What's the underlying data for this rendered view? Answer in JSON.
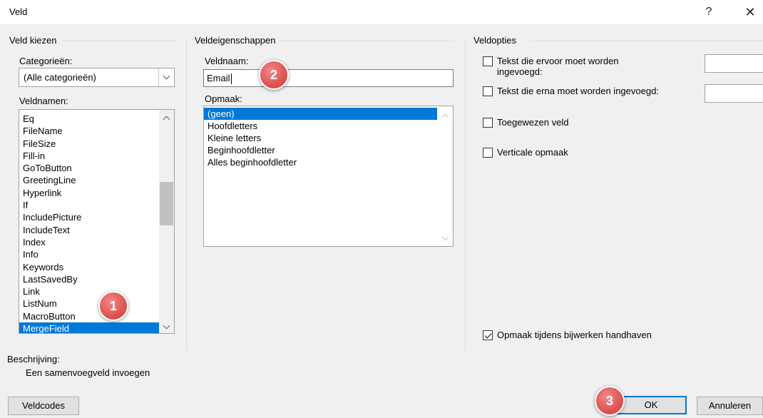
{
  "dialog": {
    "title": "Veld",
    "help": "?",
    "close": "✕"
  },
  "field_choose": {
    "legend": "Veld kiezen",
    "categories_label": "Categorieën:",
    "category_value": "(Alle categorieën)",
    "fieldnames_label": "Veldnamen:",
    "fieldnames": [
      "Eq",
      "FileName",
      "FileSize",
      "Fill-in",
      "GoToButton",
      "GreetingLine",
      "Hyperlink",
      "If",
      "IncludePicture",
      "IncludeText",
      "Index",
      "Info",
      "Keywords",
      "LastSavedBy",
      "Link",
      "ListNum",
      "MacroButton",
      "MergeField"
    ],
    "selected": "MergeField"
  },
  "field_props": {
    "legend": "Veldeigenschappen",
    "fieldname_label": "Veldnaam:",
    "fieldname_value": "Email",
    "format_label": "Opmaak:",
    "formats": [
      "(geen)",
      "Hoofdletters",
      "Kleine letters",
      "Beginhoofdletter",
      "Alles beginhoofdletter"
    ],
    "selected_format": "(geen)"
  },
  "field_options": {
    "legend": "Veldopties",
    "before_text": "Tekst die ervoor moet worden ingevoegd:",
    "before_line1": "Tekst die ervoor moet worden",
    "before_line2": "ingevoegd:",
    "after_text": "Tekst die erna moet worden ingevoegd:",
    "mapped": "Toegewezen veld",
    "vertical": "Verticale opmaak",
    "preserve": "Opmaak tijdens bijwerken handhaven",
    "before_checked": false,
    "after_checked": false,
    "mapped_checked": false,
    "vertical_checked": false,
    "preserve_checked": true
  },
  "description": {
    "label": "Beschrijving:",
    "text": "Een samenvoegveld invoegen"
  },
  "buttons": {
    "field_codes": "Veldcodes",
    "ok": "OK",
    "cancel": "Annuleren"
  },
  "badges": [
    "1",
    "2",
    "3"
  ],
  "colors": {
    "selection": "#0078d7",
    "badge": "#e05757"
  }
}
